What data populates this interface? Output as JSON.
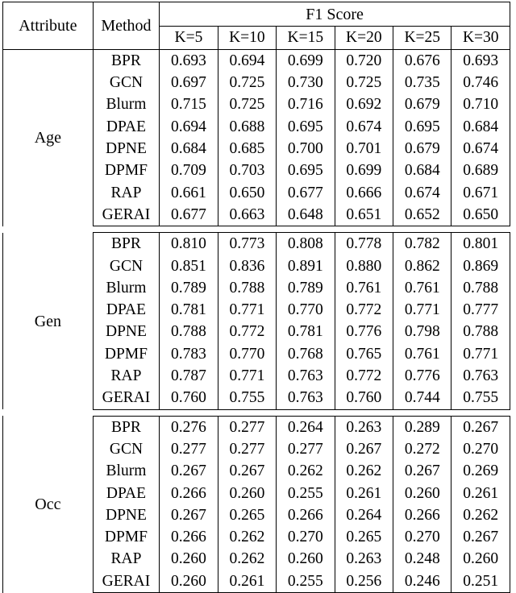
{
  "table": {
    "headers": {
      "attribute": "Attribute",
      "method": "Method",
      "metric_group": "F1 Score",
      "k_columns": [
        "K=5",
        "K=10",
        "K=15",
        "K=20",
        "K=25",
        "K=30"
      ]
    },
    "blocks": [
      {
        "attribute": "Age",
        "rows": [
          {
            "method": "BPR",
            "values": [
              "0.693",
              "0.694",
              "0.699",
              "0.720",
              "0.676",
              "0.693"
            ],
            "bold": [
              false,
              false,
              false,
              false,
              false,
              false
            ]
          },
          {
            "method": "GCN",
            "values": [
              "0.697",
              "0.725",
              "0.730",
              "0.725",
              "0.735",
              "0.746"
            ],
            "bold": [
              false,
              false,
              false,
              false,
              false,
              false
            ]
          },
          {
            "method": "Blurm",
            "values": [
              "0.715",
              "0.725",
              "0.716",
              "0.692",
              "0.679",
              "0.710"
            ],
            "bold": [
              false,
              false,
              false,
              false,
              false,
              false
            ]
          },
          {
            "method": "DPAE",
            "values": [
              "0.694",
              "0.688",
              "0.695",
              "0.674",
              "0.695",
              "0.684"
            ],
            "bold": [
              false,
              false,
              false,
              false,
              false,
              false
            ]
          },
          {
            "method": "DPNE",
            "values": [
              "0.684",
              "0.685",
              "0.700",
              "0.701",
              "0.679",
              "0.674"
            ],
            "bold": [
              false,
              false,
              false,
              false,
              false,
              false
            ]
          },
          {
            "method": "DPMF",
            "values": [
              "0.709",
              "0.703",
              "0.695",
              "0.699",
              "0.684",
              "0.689"
            ],
            "bold": [
              false,
              false,
              false,
              false,
              false,
              false
            ]
          },
          {
            "method": "RAP",
            "values": [
              "0.661",
              "0.650",
              "0.677",
              "0.666",
              "0.674",
              "0.671"
            ],
            "bold": [
              true,
              true,
              false,
              false,
              false,
              false
            ]
          }
        ],
        "summary": {
          "method": "GERAI",
          "values": [
            "0.677",
            "0.663",
            "0.648",
            "0.651",
            "0.652",
            "0.650"
          ],
          "bold": [
            false,
            false,
            true,
            true,
            true,
            true
          ]
        }
      },
      {
        "attribute": "Gen",
        "rows": [
          {
            "method": "BPR",
            "values": [
              "0.810",
              "0.773",
              "0.808",
              "0.778",
              "0.782",
              "0.801"
            ],
            "bold": [
              false,
              false,
              false,
              false,
              false,
              false
            ]
          },
          {
            "method": "GCN",
            "values": [
              "0.851",
              "0.836",
              "0.891",
              "0.880",
              "0.862",
              "0.869"
            ],
            "bold": [
              false,
              false,
              false,
              false,
              false,
              false
            ]
          },
          {
            "method": "Blurm",
            "values": [
              "0.789",
              "0.788",
              "0.789",
              "0.761",
              "0.761",
              "0.788"
            ],
            "bold": [
              false,
              false,
              false,
              false,
              false,
              false
            ]
          },
          {
            "method": "DPAE",
            "values": [
              "0.781",
              "0.771",
              "0.770",
              "0.772",
              "0.771",
              "0.777"
            ],
            "bold": [
              false,
              false,
              false,
              false,
              false,
              false
            ]
          },
          {
            "method": "DPNE",
            "values": [
              "0.788",
              "0.772",
              "0.781",
              "0.776",
              "0.798",
              "0.788"
            ],
            "bold": [
              false,
              false,
              false,
              false,
              false,
              false
            ]
          },
          {
            "method": "DPMF",
            "values": [
              "0.783",
              "0.770",
              "0.768",
              "0.765",
              "0.761",
              "0.771"
            ],
            "bold": [
              false,
              false,
              false,
              false,
              false,
              false
            ]
          },
          {
            "method": "RAP",
            "values": [
              "0.787",
              "0.771",
              "0.763",
              "0.772",
              "0.776",
              "0.763"
            ],
            "bold": [
              false,
              false,
              false,
              false,
              false,
              false
            ]
          }
        ],
        "summary": {
          "method": "GERAI",
          "values": [
            "0.760",
            "0.755",
            "0.763",
            "0.760",
            "0.744",
            "0.755"
          ],
          "bold": [
            true,
            true,
            true,
            true,
            true,
            true
          ]
        }
      },
      {
        "attribute": "Occ",
        "rows": [
          {
            "method": "BPR",
            "values": [
              "0.276",
              "0.277",
              "0.264",
              "0.263",
              "0.289",
              "0.267"
            ],
            "bold": [
              false,
              false,
              false,
              false,
              false,
              false
            ]
          },
          {
            "method": "GCN",
            "values": [
              "0.277",
              "0.277",
              "0.277",
              "0.267",
              "0.272",
              "0.270"
            ],
            "bold": [
              false,
              false,
              false,
              false,
              false,
              false
            ]
          },
          {
            "method": "Blurm",
            "values": [
              "0.267",
              "0.267",
              "0.262",
              "0.262",
              "0.267",
              "0.269"
            ],
            "bold": [
              false,
              false,
              false,
              false,
              false,
              false
            ]
          },
          {
            "method": "DPAE",
            "values": [
              "0.266",
              "0.260",
              "0.255",
              "0.261",
              "0.260",
              "0.261"
            ],
            "bold": [
              false,
              false,
              false,
              false,
              false,
              false
            ]
          },
          {
            "method": "DPNE",
            "values": [
              "0.267",
              "0.265",
              "0.266",
              "0.264",
              "0.266",
              "0.262"
            ],
            "bold": [
              false,
              false,
              false,
              false,
              false,
              false
            ]
          },
          {
            "method": "DPMF",
            "values": [
              "0.266",
              "0.262",
              "0.270",
              "0.265",
              "0.270",
              "0.267"
            ],
            "bold": [
              false,
              false,
              false,
              false,
              false,
              false
            ]
          },
          {
            "method": "RAP",
            "values": [
              "0.260",
              "0.262",
              "0.260",
              "0.263",
              "0.248",
              "0.260"
            ],
            "bold": [
              false,
              false,
              false,
              false,
              false,
              false
            ]
          }
        ],
        "summary": {
          "method": "GERAI",
          "values": [
            "0.260",
            "0.261",
            "0.255",
            "0.256",
            "0.246",
            "0.251"
          ],
          "bold": [
            true,
            true,
            true,
            true,
            true,
            true
          ]
        }
      }
    ]
  }
}
